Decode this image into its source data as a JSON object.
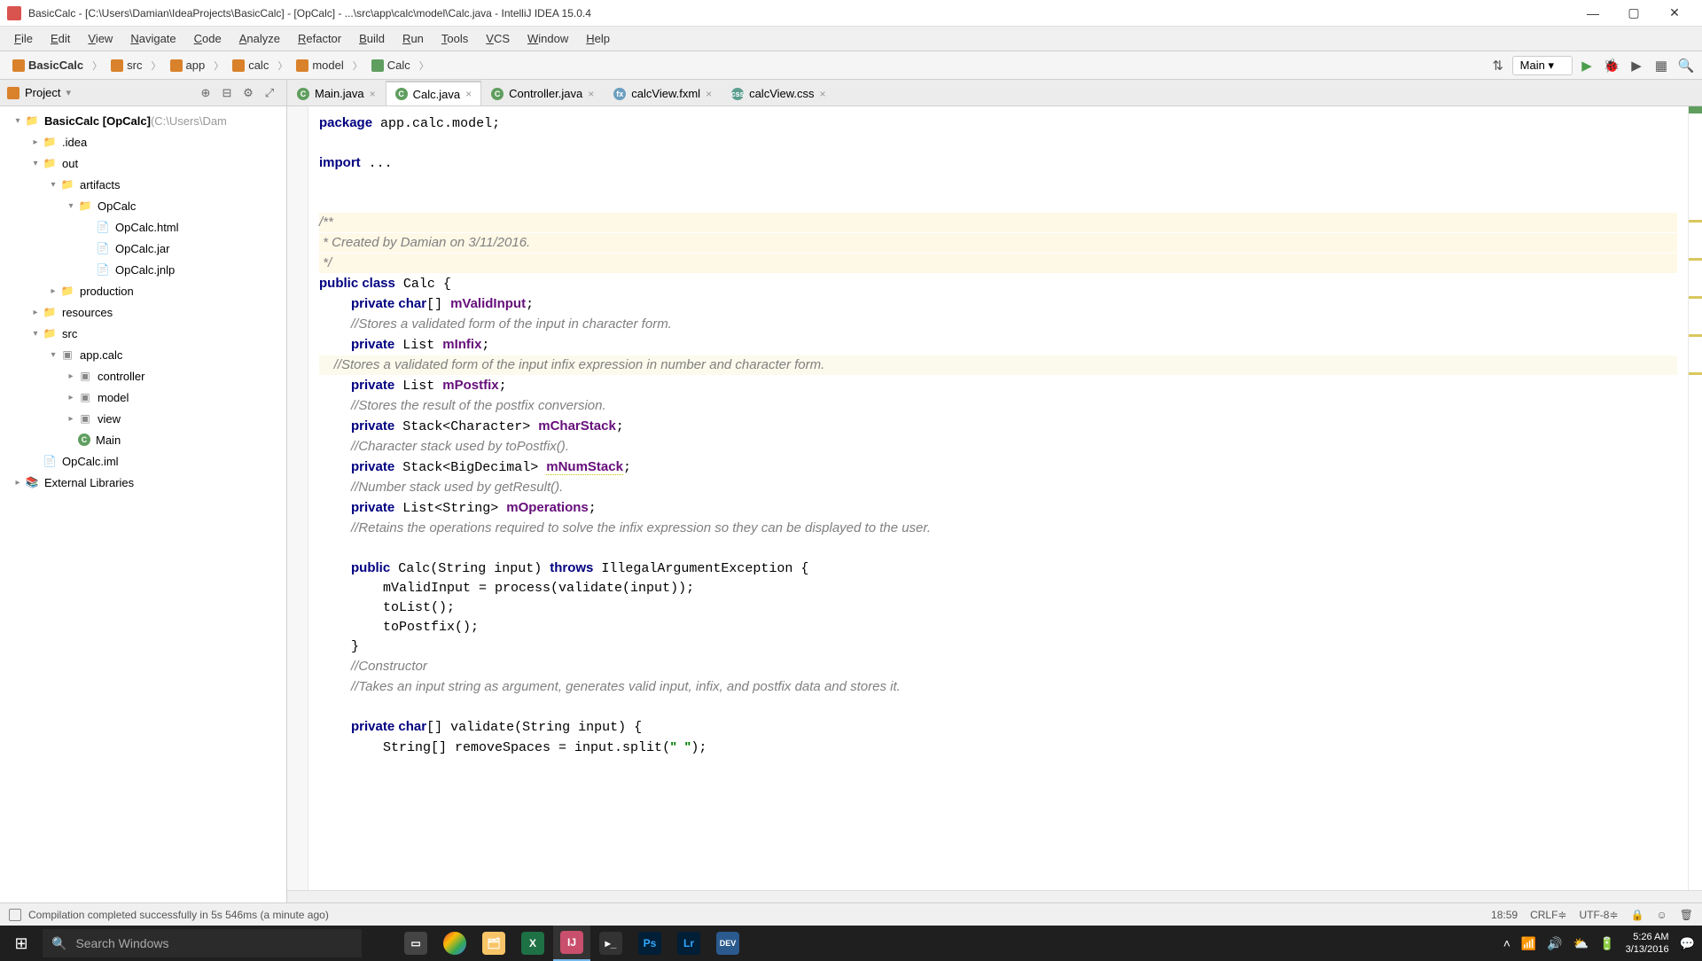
{
  "window": {
    "title": "BasicCalc - [C:\\Users\\Damian\\IdeaProjects\\BasicCalc] - [OpCalc] - ...\\src\\app\\calc\\model\\Calc.java - IntelliJ IDEA 15.0.4"
  },
  "menu": [
    "File",
    "Edit",
    "View",
    "Navigate",
    "Code",
    "Analyze",
    "Refactor",
    "Build",
    "Run",
    "Tools",
    "VCS",
    "Window",
    "Help"
  ],
  "breadcrumbs": [
    {
      "icon": "#d9822b",
      "label": "BasicCalc",
      "bold": true
    },
    {
      "icon": "#d9822b",
      "label": "src"
    },
    {
      "icon": "#d9822b",
      "label": "app"
    },
    {
      "icon": "#d9822b",
      "label": "calc"
    },
    {
      "icon": "#d9822b",
      "label": "model"
    },
    {
      "icon": "#5f9e5f",
      "label": "Calc"
    }
  ],
  "run_config": "Main",
  "sidebar": {
    "title": "Project",
    "tree": [
      {
        "depth": 0,
        "arrow": "▾",
        "icon": "folder",
        "label": "BasicCalc [OpCalc]",
        "bold": true,
        "suffix": " (C:\\Users\\Dam"
      },
      {
        "depth": 1,
        "arrow": "▸",
        "icon": "folder",
        "label": ".idea"
      },
      {
        "depth": 1,
        "arrow": "▾",
        "icon": "folder",
        "label": "out"
      },
      {
        "depth": 2,
        "arrow": "▾",
        "icon": "folder",
        "label": "artifacts"
      },
      {
        "depth": 3,
        "arrow": "▾",
        "icon": "folder",
        "label": "OpCalc"
      },
      {
        "depth": 4,
        "arrow": "",
        "icon": "file",
        "label": "OpCalc.html"
      },
      {
        "depth": 4,
        "arrow": "",
        "icon": "file",
        "label": "OpCalc.jar"
      },
      {
        "depth": 4,
        "arrow": "",
        "icon": "file",
        "label": "OpCalc.jnlp"
      },
      {
        "depth": 2,
        "arrow": "▸",
        "icon": "folder",
        "label": "production"
      },
      {
        "depth": 1,
        "arrow": "▸",
        "icon": "folder",
        "label": "resources"
      },
      {
        "depth": 1,
        "arrow": "▾",
        "icon": "folder",
        "label": "src"
      },
      {
        "depth": 2,
        "arrow": "▾",
        "icon": "pkg",
        "label": "app.calc"
      },
      {
        "depth": 3,
        "arrow": "▸",
        "icon": "pkg",
        "label": "controller"
      },
      {
        "depth": 3,
        "arrow": "▸",
        "icon": "pkg",
        "label": "model"
      },
      {
        "depth": 3,
        "arrow": "▸",
        "icon": "pkg",
        "label": "view"
      },
      {
        "depth": 3,
        "arrow": "",
        "icon": "class",
        "label": "Main"
      },
      {
        "depth": 1,
        "arrow": "",
        "icon": "file",
        "label": "OpCalc.iml"
      },
      {
        "depth": 0,
        "arrow": "▸",
        "icon": "lib",
        "label": "External Libraries"
      }
    ]
  },
  "tabs": [
    {
      "icon": "#5f9e5f",
      "letter": "C",
      "label": "Main.java",
      "active": false
    },
    {
      "icon": "#5f9e5f",
      "letter": "C",
      "label": "Calc.java",
      "active": true
    },
    {
      "icon": "#5f9e5f",
      "letter": "C",
      "label": "Controller.java",
      "active": false
    },
    {
      "icon": "#6b9ebf",
      "letter": "fx",
      "label": "calcView.fxml",
      "active": false
    },
    {
      "icon": "#5c9e8f",
      "letter": "css",
      "label": "calcView.css",
      "active": false
    }
  ],
  "code": {
    "package": "app.calc.model",
    "doc1": "/**",
    "doc2": " * Created by Damian on 3/11/2016.",
    "doc3": " */",
    "class_name": "Calc",
    "f1": "mValidInput",
    "c1": "//Stores a validated form of the input in character form.",
    "f2": "mInfix",
    "c2": "//Stores a validated form of the input infix expression in number and character form.",
    "f3": "mPostfix",
    "c3": "//Stores the result of the postfix conversion.",
    "f4": "mCharStack",
    "c4": "//Character stack used by toPostfix().",
    "f5": "mNumStack",
    "c5": "//Number stack used by getResult().",
    "f6": "mOperations",
    "c6": "//Retains the operations required to solve the infix expression so they can be displayed to the user.",
    "ctor1": "mValidInput = process(validate(input));",
    "ctor2": "toList();",
    "ctor3": "toPostfix();",
    "c7": "//Constructor",
    "c8": "//Takes an input string as argument, generates valid input, infix, and postfix data and stores it.",
    "val1": "String[] removeSpaces = input.split(\" \");"
  },
  "status": {
    "message": "Compilation completed successfully in 5s 546ms (a minute ago)",
    "pos": "18:59",
    "lineend": "CRLF",
    "encoding": "UTF-8"
  },
  "taskbar": {
    "search_placeholder": "Search Windows",
    "time": "5:26 AM",
    "date": "3/13/2016"
  }
}
